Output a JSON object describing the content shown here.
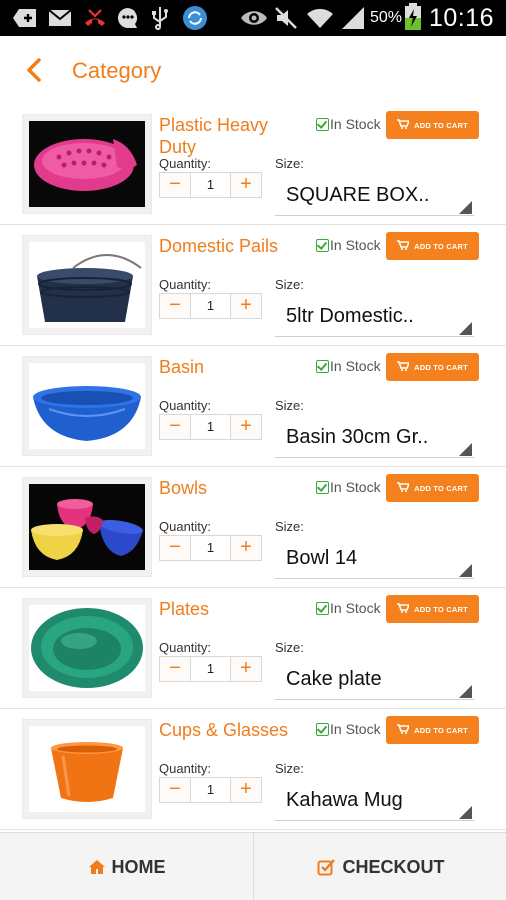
{
  "status_bar": {
    "battery_percent": "50%",
    "time": "10:16",
    "icons": [
      "add-icon",
      "mail-icon",
      "missed-call-icon",
      "chat-icon",
      "usb-icon",
      "sync-app-icon",
      "eye-icon",
      "mute-icon",
      "wifi-icon",
      "signal-icon",
      "battery-charging-icon"
    ]
  },
  "header": {
    "back_icon": "chevron-left-icon",
    "title": "Category"
  },
  "common": {
    "quantity_label": "Quantity:",
    "size_label": "Size:",
    "stock_text": "In Stock",
    "add_to_cart_label": "ADD TO CART",
    "minus": "−",
    "plus": "+"
  },
  "products": [
    {
      "name": "Plastic Heavy Duty",
      "quantity": "1",
      "size": "SQUARE BOX..",
      "image": "pink-basket"
    },
    {
      "name": "Domestic Pails",
      "quantity": "1",
      "size": "5ltr Domestic..",
      "image": "dark-pails"
    },
    {
      "name": "Basin",
      "quantity": "1",
      "size": "Basin 30cm Gr..",
      "image": "blue-basin"
    },
    {
      "name": "Bowls",
      "quantity": "1",
      "size": "Bowl 14",
      "image": "colored-bowls"
    },
    {
      "name": "Plates",
      "quantity": "1",
      "size": "Cake plate",
      "image": "green-plate"
    },
    {
      "name": "Cups & Glasses",
      "quantity": "1",
      "size": "Kahawa Mug",
      "image": "orange-mug"
    }
  ],
  "bottom_bar": {
    "home_label": "HOME",
    "checkout_label": "CHECKOUT"
  },
  "colors": {
    "accent": "#f07d1c",
    "button": "#f5811e",
    "in_stock": "#3aa83a"
  }
}
